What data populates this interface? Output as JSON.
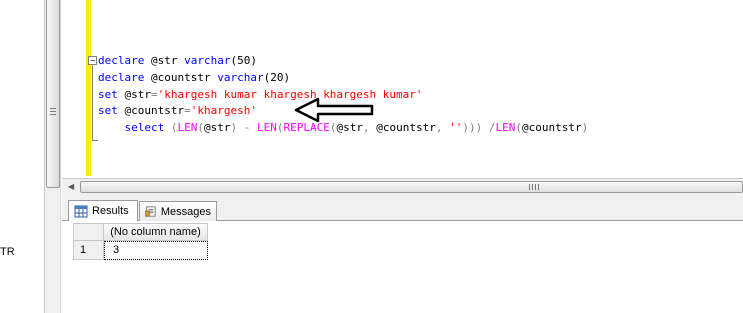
{
  "left_panel": {
    "label": "TR"
  },
  "editor": {
    "lines": [
      {
        "tokens": [
          {
            "t": "declare",
            "c": "kw"
          },
          {
            "t": " @str ",
            "c": "txt"
          },
          {
            "t": "varchar",
            "c": "kw"
          },
          {
            "t": "(50)",
            "c": "txt"
          }
        ]
      },
      {
        "tokens": [
          {
            "t": "declare",
            "c": "kw"
          },
          {
            "t": " @countstr ",
            "c": "txt"
          },
          {
            "t": "varchar",
            "c": "kw"
          },
          {
            "t": "(20)",
            "c": "txt"
          }
        ]
      },
      {
        "tokens": [
          {
            "t": "set",
            "c": "kw"
          },
          {
            "t": " @str",
            "c": "txt"
          },
          {
            "t": "=",
            "c": "op"
          },
          {
            "t": "'khargesh kumar khargesh khargesh kumar'",
            "c": "str"
          }
        ]
      },
      {
        "tokens": [
          {
            "t": "set",
            "c": "kw"
          },
          {
            "t": " @countstr",
            "c": "txt"
          },
          {
            "t": "=",
            "c": "op"
          },
          {
            "t": "'khargesh'",
            "c": "str"
          }
        ]
      },
      {
        "tokens": [
          {
            "t": "    ",
            "c": "txt"
          },
          {
            "t": "select",
            "c": "kw"
          },
          {
            "t": " ",
            "c": "txt"
          },
          {
            "t": "(",
            "c": "op"
          },
          {
            "t": "LEN",
            "c": "fn"
          },
          {
            "t": "(",
            "c": "op"
          },
          {
            "t": "@str",
            "c": "txt"
          },
          {
            "t": ")",
            "c": "op"
          },
          {
            "t": " ",
            "c": "txt"
          },
          {
            "t": "-",
            "c": "op"
          },
          {
            "t": " ",
            "c": "txt"
          },
          {
            "t": "LEN",
            "c": "fn"
          },
          {
            "t": "(",
            "c": "op"
          },
          {
            "t": "REPLACE",
            "c": "fn"
          },
          {
            "t": "(",
            "c": "op"
          },
          {
            "t": "@str",
            "c": "txt"
          },
          {
            "t": ",",
            "c": "op"
          },
          {
            "t": " @countstr",
            "c": "txt"
          },
          {
            "t": ",",
            "c": "op"
          },
          {
            "t": " ",
            "c": "txt"
          },
          {
            "t": "''",
            "c": "str"
          },
          {
            "t": ")))",
            "c": "op"
          },
          {
            "t": " ",
            "c": "txt"
          },
          {
            "t": "/",
            "c": "op"
          },
          {
            "t": "LEN",
            "c": "fn"
          },
          {
            "t": "(",
            "c": "op"
          },
          {
            "t": "@countstr",
            "c": "txt"
          },
          {
            "t": ")",
            "c": "op"
          }
        ]
      }
    ],
    "collapse_symbol": "−",
    "colors": {
      "keyword": "#0000ff",
      "string": "#ff0000",
      "function": "#ff00ff",
      "operator": "#808080",
      "margin_marker": "#ffec00"
    }
  },
  "results_tabs": [
    {
      "label": "Results",
      "icon": "grid-icon",
      "active": true
    },
    {
      "label": "Messages",
      "icon": "messages-icon",
      "active": false
    }
  ],
  "results_grid": {
    "columns": [
      "(No column name)"
    ],
    "rows": [
      {
        "row_number": "1",
        "cells": [
          "3"
        ]
      }
    ]
  }
}
